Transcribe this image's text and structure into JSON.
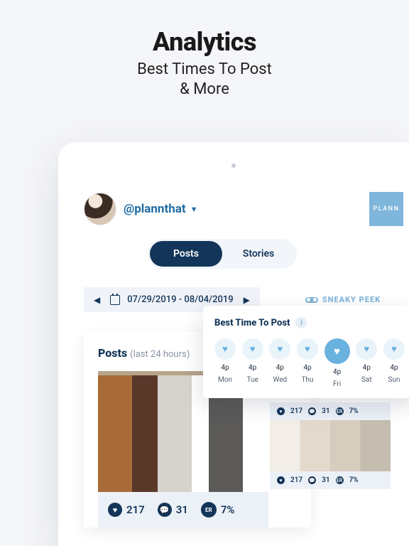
{
  "hero": {
    "title": "Analytics",
    "sub1": "Best Times To Post",
    "sub2": "& More"
  },
  "user": {
    "handle": "@plannthat"
  },
  "brand": "PLANN",
  "tabs": {
    "posts": "Posts",
    "stories": "Stories"
  },
  "dates": {
    "range": "07/29/2019 - 08/04/2019"
  },
  "sneaky": "SNEAKY PEEK",
  "posts_card": {
    "title": "Posts",
    "span": "(last 24 hours)"
  },
  "stats": {
    "likes": "217",
    "comments": "31",
    "er_label": "ER",
    "rate": "7%"
  },
  "btp": {
    "title": "Best Time To Post",
    "days": [
      {
        "t": "4p",
        "d": "Mon",
        "sel": false
      },
      {
        "t": "4p",
        "d": "Tue",
        "sel": false
      },
      {
        "t": "4p",
        "d": "Wed",
        "sel": false
      },
      {
        "t": "4p",
        "d": "Thu",
        "sel": false
      },
      {
        "t": "4p",
        "d": "Fri",
        "sel": true
      },
      {
        "t": "4p",
        "d": "Sat",
        "sel": false
      },
      {
        "t": "4p",
        "d": "Sun",
        "sel": false
      }
    ]
  },
  "mini": {
    "likes": "217",
    "comments": "31",
    "rate": "7%"
  }
}
